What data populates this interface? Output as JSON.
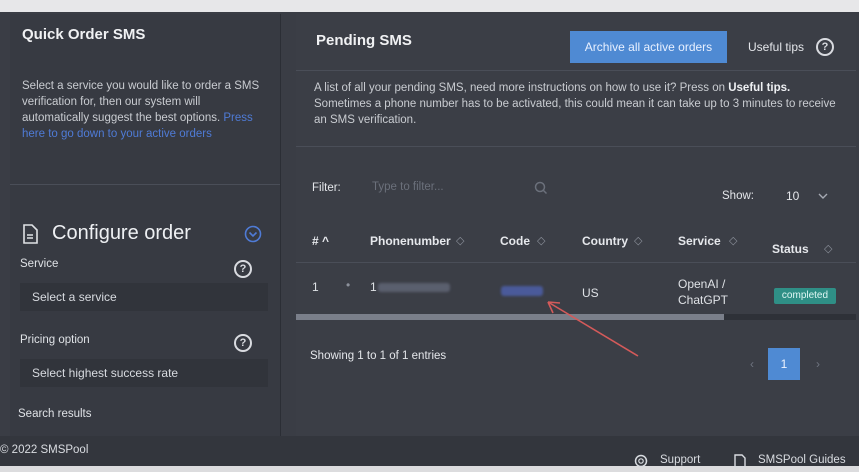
{
  "left": {
    "title": "Quick Order SMS",
    "intro": "Select a service you would like to order a SMS verification for, then our system will automatically suggest the best options.",
    "intro_link": "Press here to go down to your active orders",
    "configure_title": "Configure order",
    "service_label": "Service",
    "service_value": "Select a service",
    "pricing_label": "Pricing option",
    "pricing_value": "Select highest success rate",
    "search_results": "Search results"
  },
  "right": {
    "title": "Pending SMS",
    "archive_button": "Archive all active orders",
    "tips_button": "Useful tips",
    "desc_pre": "A list of all your pending SMS, need more instructions on how to use it? Press on ",
    "desc_bold": "Useful tips.",
    "desc_post": " Sometimes a phone number has to be activated, this could mean it can take up to 3 minutes to receive an SMS verification.",
    "filter_label": "Filter:",
    "filter_placeholder": "Type to filter...",
    "show_label": "Show:",
    "show_value": "10",
    "columns": [
      "# ^",
      "Phonenumber",
      "Code",
      "Country",
      "Service",
      "Status"
    ],
    "row": {
      "index": "1",
      "phone": "1",
      "country": "US",
      "service": "OpenAI / ChatGPT",
      "status": "completed"
    },
    "showing": "Showing 1 to 1 of 1 entries",
    "page": "1"
  },
  "footer": {
    "copyright": "2022 SMSPool",
    "support": "Support",
    "guides": "SMSPool Guides"
  },
  "colors": {
    "accent": "#4f8ad3",
    "status_completed": "#2f8f86",
    "annotation_arrow": "#d45a5a"
  }
}
